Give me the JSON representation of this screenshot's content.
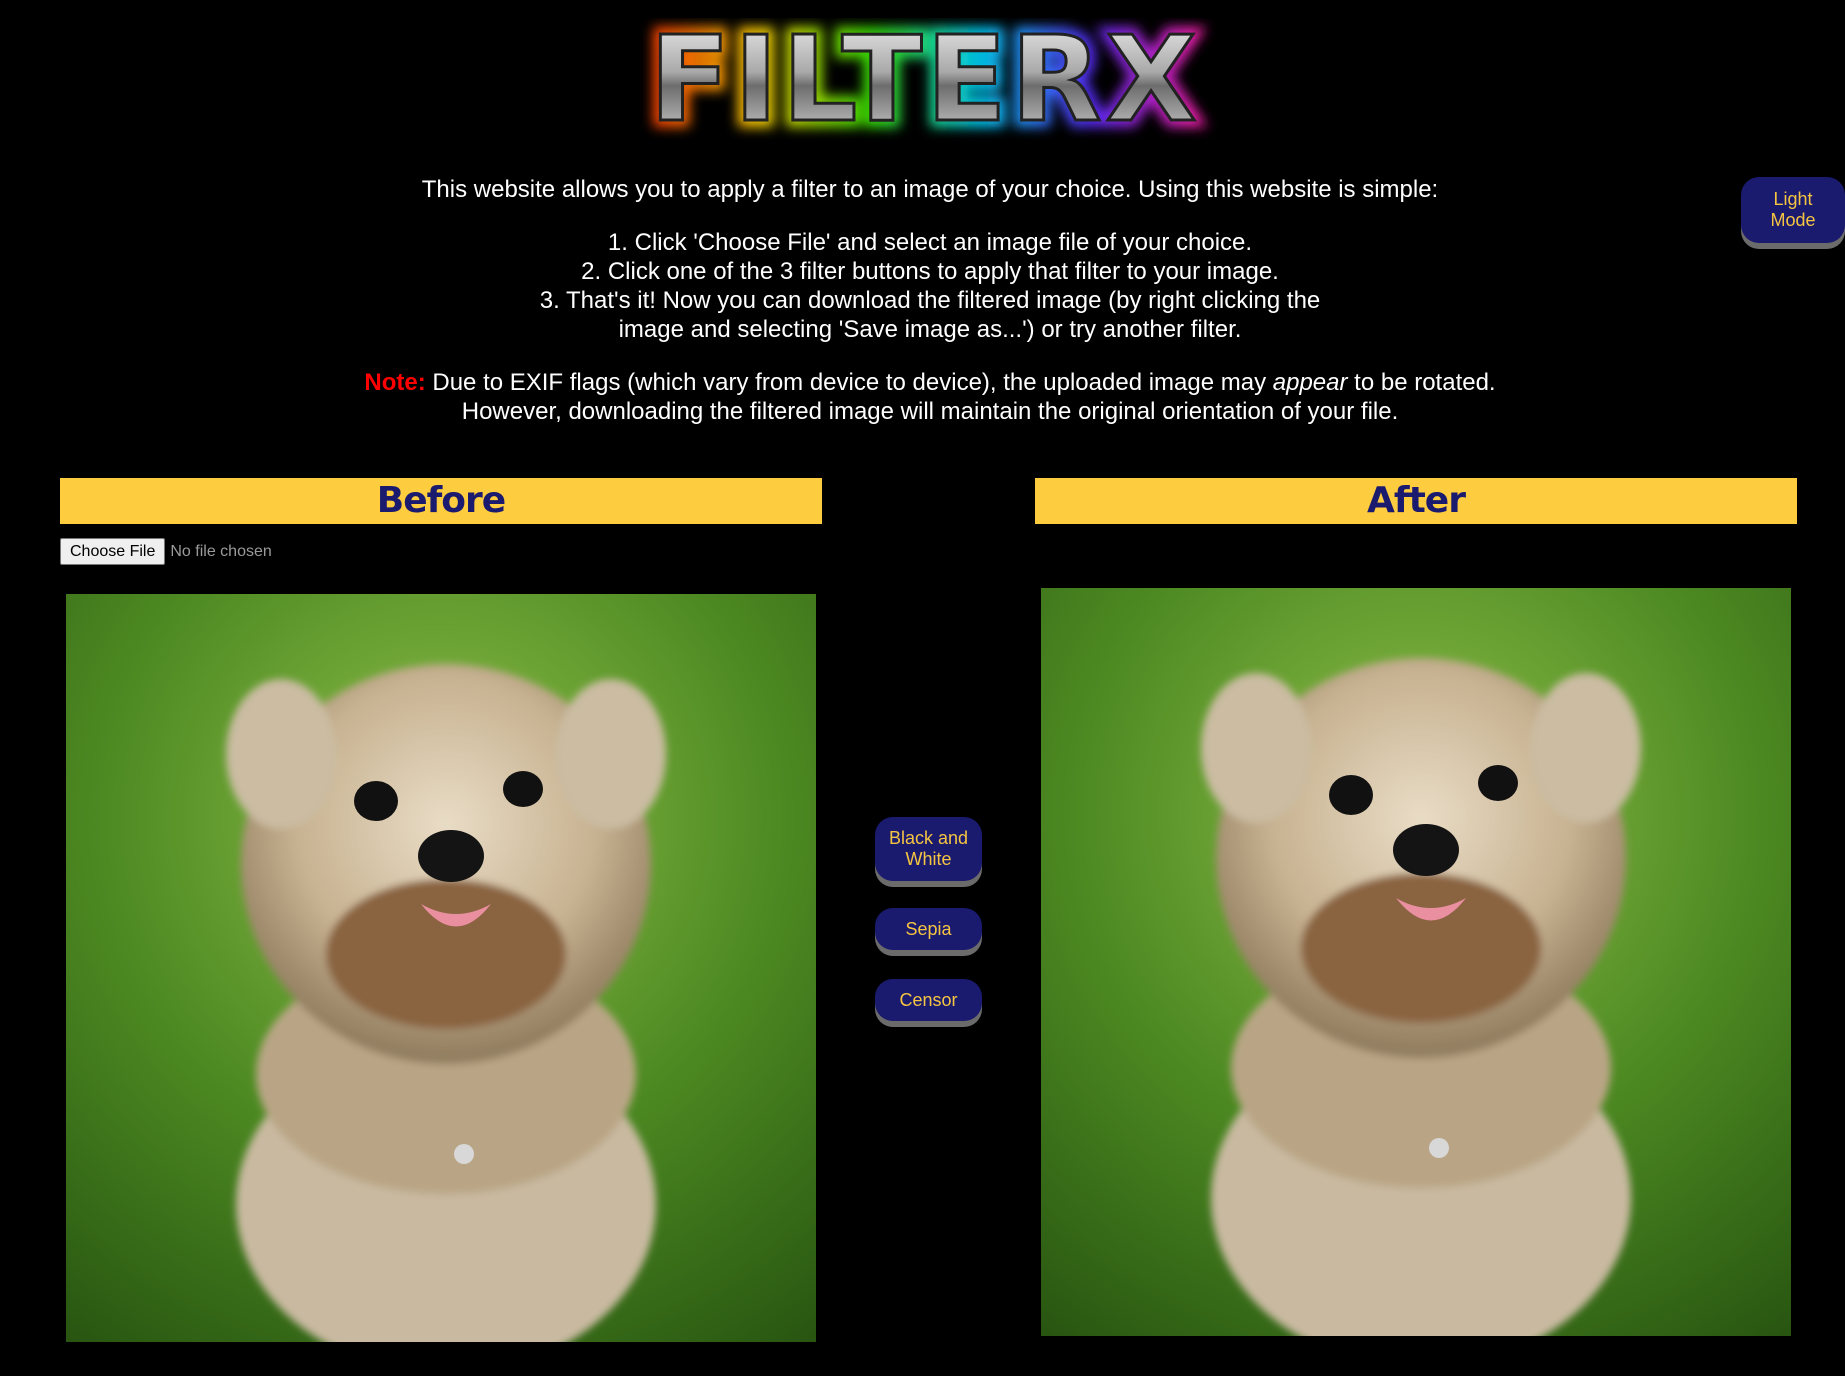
{
  "logo": {
    "text": "FILTERX"
  },
  "theme_toggle": {
    "label": "Light\nMode"
  },
  "intro": {
    "lead": "This website allows you to apply a filter to an image of your choice. Using this website is simple:",
    "steps": [
      "1. Click 'Choose File' and select an image file of your choice.",
      "2. Click one of the 3 filter buttons to apply that filter to your image.",
      "3. That's it! Now you can download the filtered image (by right clicking the",
      "image and selecting 'Save image as...') or try another filter."
    ],
    "note_label": "Note:",
    "note_part1": " Due to EXIF flags (which vary from device to device), the uploaded image may ",
    "note_em": "appear",
    "note_part2": " to be rotated.",
    "note_line2": "However, downloading the filtered image will maintain the original orientation of your file."
  },
  "before": {
    "title": "Before",
    "choose_file_label": "Choose File",
    "file_status": "No file chosen"
  },
  "after": {
    "title": "After"
  },
  "filters": {
    "black_and_white": "Black and\nWhite",
    "sepia": "Sepia",
    "censor": "Censor"
  },
  "colors": {
    "background": "#000000",
    "header_bg": "#fecc3f",
    "header_text": "#1a1a6e",
    "button_bg": "#1a1a6e",
    "button_text": "#f5c542",
    "note_red": "#ff0000"
  }
}
